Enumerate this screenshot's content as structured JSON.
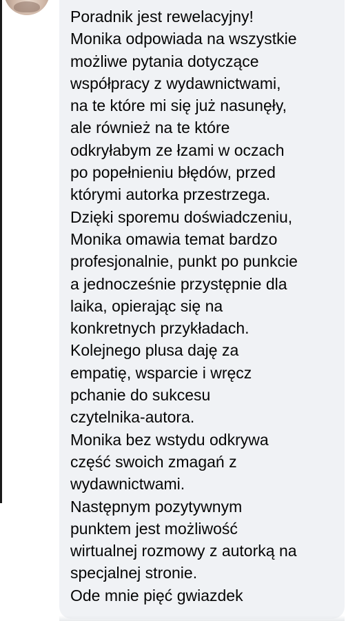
{
  "comment": {
    "lines": [
      "Poradnik jest rewelacyjny!",
      "Monika odpowiada na wszystkie",
      "możliwe pytania dotyczące",
      "współpracy z wydawnictwami,",
      "na te które mi się już nasunęły,",
      "ale również na te które",
      "odkryłabym ze łzami w oczach",
      "po popełnieniu błędów, przed",
      "którymi autorka przestrzega.",
      "Dzięki sporemu doświadczeniu,",
      "Monika omawia temat bardzo",
      "profesjonalnie, punkt po punkcie",
      "a jednocześnie przystępnie dla",
      "laika, opierając się na",
      "konkretnych przykładach.",
      "Kolejnego plusa daję za",
      "empatię, wsparcie i wręcz",
      "pchanie do sukcesu",
      "czytelnika-autora.",
      "Monika bez wstydu odkrywa",
      "część swoich zmagań z",
      "wydawnictwami.",
      "Następnym pozytywnym",
      "punktem jest możliwość",
      "wirtualnej rozmowy z autorką na",
      "specjalnej stronie.",
      "Ode mnie pięć gwiazdek"
    ]
  },
  "colors": {
    "bubble_background": "#f0f2f5",
    "text": "#050505"
  }
}
